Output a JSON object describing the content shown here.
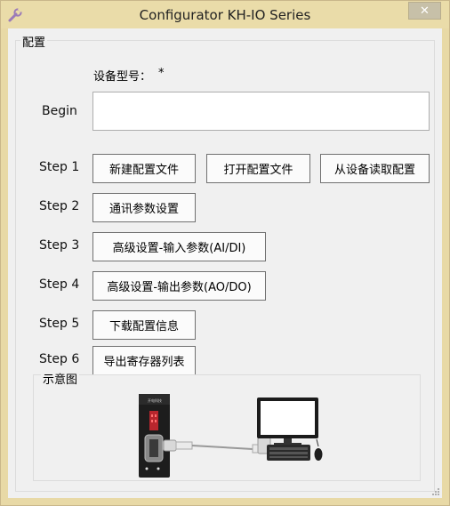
{
  "window": {
    "title": "Configurator KH-IO Series",
    "close_label": "✕",
    "colors": {
      "frame": "#e8d9a6",
      "client": "#f0f0f0",
      "button_border": "#707070"
    }
  },
  "config_group": {
    "title": "配置",
    "device_model_label": "设备型号：",
    "device_model_value": "*",
    "begin_label": "Begin",
    "begin_value": ""
  },
  "steps": [
    {
      "label": "Step 1",
      "buttons": [
        "新建配置文件",
        "打开配置文件",
        "从设备读取配置"
      ]
    },
    {
      "label": "Step 2",
      "buttons": [
        "通讯参数设置"
      ]
    },
    {
      "label": "Step 3",
      "buttons": [
        "高级设置-输入参数(AI/DI)"
      ]
    },
    {
      "label": "Step 4",
      "buttons": [
        "高级设置-输出参数(AO/DO)"
      ]
    },
    {
      "label": "Step 5",
      "buttons": [
        "下载配置信息"
      ]
    },
    {
      "label": "Step 6",
      "buttons": [
        "导出寄存器列表"
      ]
    }
  ],
  "diagram": {
    "title": "示意图",
    "device_brand": "开电科技",
    "icons": [
      "io-module-icon",
      "serial-cable-icon",
      "monitor-icon",
      "keyboard-icon",
      "mouse-icon"
    ]
  }
}
